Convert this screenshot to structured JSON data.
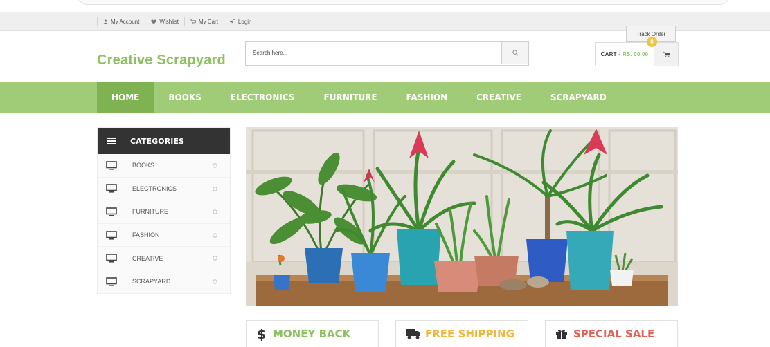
{
  "topbar": {
    "links": [
      {
        "label": "My Account",
        "icon": "user-icon"
      },
      {
        "label": "Wishlist",
        "icon": "heart-icon"
      },
      {
        "label": "My Cart",
        "icon": "cart-icon"
      },
      {
        "label": "Login",
        "icon": "login-icon"
      }
    ],
    "track_order": "Track Order"
  },
  "header": {
    "logo": "Creative Scrapyard",
    "search_placeholder": "Search here...",
    "cart_label": "CART -",
    "cart_amount": "RS. 00.00",
    "cart_count": "0"
  },
  "nav": {
    "items": [
      {
        "label": "HOME"
      },
      {
        "label": "BOOKS"
      },
      {
        "label": "ELECTRONICS"
      },
      {
        "label": "FURNITURE"
      },
      {
        "label": "FASHION"
      },
      {
        "label": "CREATIVE"
      },
      {
        "label": "SCRAPYARD"
      }
    ],
    "active_index": 0
  },
  "categories": {
    "title": "CATEGORIES",
    "items": [
      {
        "label": "BOOKS"
      },
      {
        "label": "ELECTRONICS"
      },
      {
        "label": "FURNITURE"
      },
      {
        "label": "FASHION"
      },
      {
        "label": "CREATIVE"
      },
      {
        "label": "SCRAPYARD"
      }
    ]
  },
  "features": [
    {
      "label": "MONEY BACK",
      "icon": "dollar-icon",
      "color": "#8dc061"
    },
    {
      "label": "FREE SHIPPING",
      "icon": "truck-icon",
      "color": "#f0b73d"
    },
    {
      "label": "SPECIAL SALE",
      "icon": "gift-icon",
      "color": "#e0635a"
    }
  ],
  "colors": {
    "accent_green": "#8dc061",
    "nav_green": "#a0cc77",
    "nav_active": "#7fb250",
    "dark": "#333333",
    "badge_yellow": "#f0c43b"
  }
}
